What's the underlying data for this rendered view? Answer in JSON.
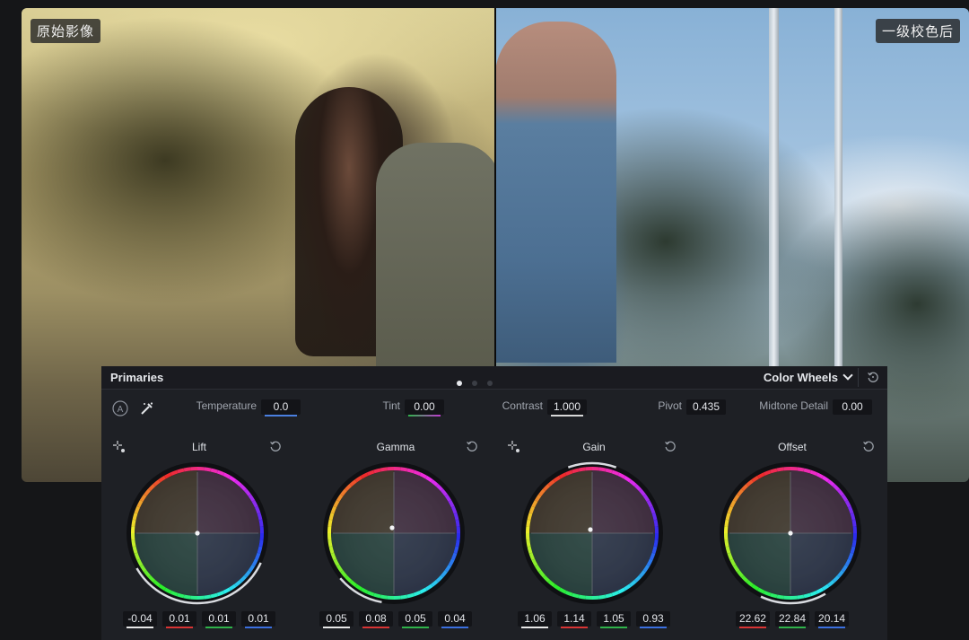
{
  "viewer": {
    "label_original": "原始影像",
    "label_graded": "一级校色后"
  },
  "panel": {
    "title": "Primaries",
    "mode": "Color Wheels",
    "pages": 3,
    "active_page": 1
  },
  "controls": {
    "temperature": {
      "label": "Temperature",
      "value": "0.0",
      "color": "#4a7fe0"
    },
    "tint": {
      "label": "Tint",
      "value": "0.00",
      "color": "#c03ad0"
    },
    "contrast": {
      "label": "Contrast",
      "value": "1.000",
      "color": "#d8d8d8"
    },
    "pivot": {
      "label": "Pivot",
      "value": "0.435"
    },
    "midtone_detail": {
      "label": "Midtone Detail",
      "value": "0.00"
    }
  },
  "wheels": [
    {
      "name": "Lift",
      "values": [
        "-0.04",
        "0.01",
        "0.01",
        "0.01"
      ]
    },
    {
      "name": "Gamma",
      "values": [
        "0.05",
        "0.08",
        "0.05",
        "0.04"
      ]
    },
    {
      "name": "Gain",
      "values": [
        "1.06",
        "1.14",
        "1.05",
        "0.93"
      ]
    },
    {
      "name": "Offset",
      "values": [
        "22.62",
        "22.84",
        "20.14"
      ]
    }
  ],
  "channel_colors": [
    "#e8e8e8",
    "#d83434",
    "#2fb34a",
    "#3b6fe0"
  ]
}
